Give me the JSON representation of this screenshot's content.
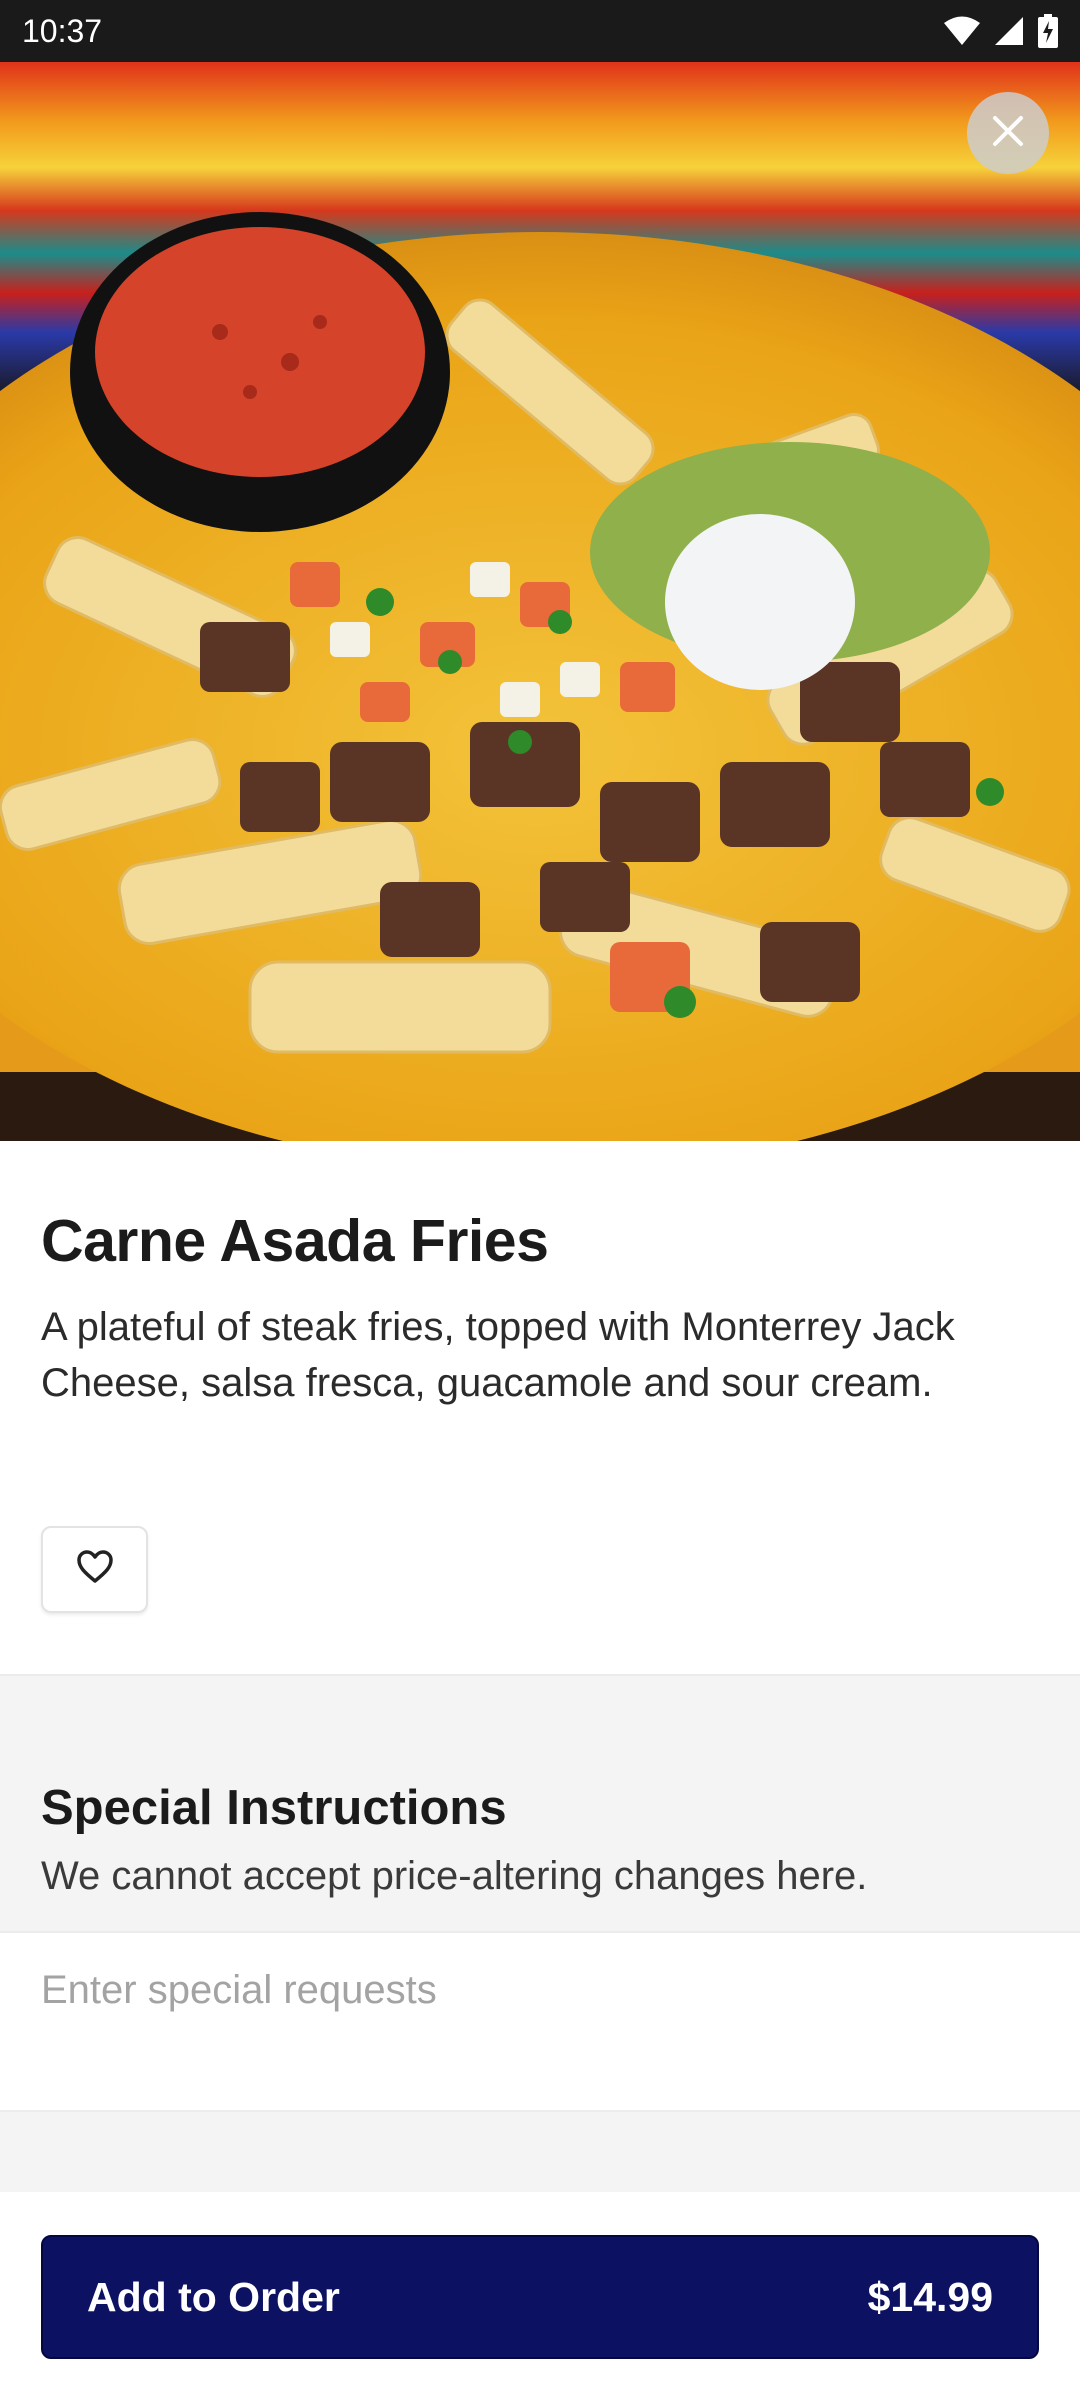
{
  "status_bar": {
    "time": "10:37",
    "icons": [
      "wifi-icon",
      "cell-signal-icon",
      "battery-charging-icon"
    ]
  },
  "hero": {
    "image_subject": "carne asada fries with salsa, guacamole and sour cream",
    "close_icon": "close-icon"
  },
  "item": {
    "title": "Carne Asada Fries",
    "description": "A plateful of steak fries, topped with Monterrey Jack Cheese, salsa fresca, guacamole and sour cream.",
    "favorite_icon": "heart-outline-icon"
  },
  "special_instructions": {
    "title": "Special Instructions",
    "subtitle": "We cannot accept price-altering changes here.",
    "placeholder": "Enter special requests",
    "value": ""
  },
  "footer": {
    "add_label": "Add to Order",
    "price": "$14.99"
  },
  "colors": {
    "accent": "#0c1161",
    "status_bar": "#1a1a1a",
    "section_gray": "#f4f4f4"
  }
}
